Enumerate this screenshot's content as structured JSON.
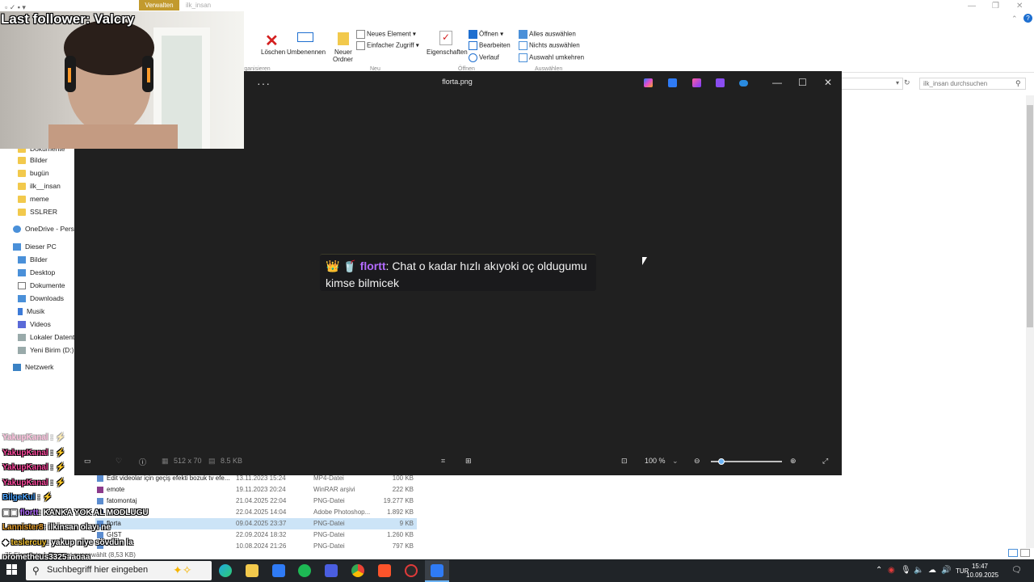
{
  "ribbon": {
    "context_tab": "Verwalten",
    "path_tab": "ilk_insan",
    "delete_label": "Löschen",
    "rename_label": "Umbenennen",
    "new_folder_label_1": "Neuer",
    "new_folder_label_2": "Ordner",
    "new_element_label": "Neues Element",
    "easy_access_label": "Einfacher Zugriff",
    "new_group": "Neu",
    "properties_label": "Eigenschaften",
    "open_label": "Öffnen",
    "edit_label": "Bearbeiten",
    "history_label": "Verlauf",
    "open_group": "Öffnen",
    "select_all": "Alles auswählen",
    "select_none": "Nichts auswählen",
    "invert_selection": "Auswahl umkehren",
    "select_group": "Auswählen",
    "organize_group": "rganisieren"
  },
  "search": {
    "placeholder": "ilk_insan durchsuchen"
  },
  "nav": {
    "items": [
      "Dokumente",
      "Bilder",
      "bugün",
      "ilk__insan",
      "meme",
      "SSLRER",
      "OneDrive - Persor",
      "Dieser PC",
      "Bilder",
      "Desktop",
      "Dokumente",
      "Downloads",
      "Musik",
      "Videos",
      "Lokaler Datentra",
      "Yeni Birim (D:)",
      "Netzwerk"
    ]
  },
  "viewer": {
    "title": "florta.png",
    "more": "···",
    "dimensions": "512 x 70",
    "filesize": "8.5 KB",
    "zoom": "100 %",
    "zoom_level": 0.15
  },
  "chat_message": {
    "emotes": "👑 🥤",
    "user": "flortt",
    "text": ": Chat o kadar hızlı akıyoki oç oldugumu kimse bilmicek"
  },
  "files": [
    {
      "name": "Edit videolar için geçiş efekti bozuk tv efe...",
      "date": "13.11.2023 15:24",
      "type": "MP4-Datei",
      "size": "100 KB"
    },
    {
      "name": "emote",
      "date": "19.11.2023 20:24",
      "type": "WinRAR arşivi",
      "size": "222 KB"
    },
    {
      "name": "fatomontaj",
      "date": "21.04.2025 22:04",
      "type": "PNG-Datei",
      "size": "19.277 KB"
    },
    {
      "name": "",
      "date": "22.04.2025 14:04",
      "type": "Adobe Photoshop...",
      "size": "1.892 KB"
    },
    {
      "name": "florta",
      "date": "09.04.2025 23:37",
      "type": "PNG-Datei",
      "size": "9 KB"
    },
    {
      "name": "GIST",
      "date": "22.09.2024 18:32",
      "type": "PNG-Datei",
      "size": "1.260 KB"
    },
    {
      "name": "",
      "date": "10.08.2024 21:26",
      "type": "PNG-Datei",
      "size": "797 KB"
    }
  ],
  "status_bar": "75 Elemente     1 Element ausgewählt (8,53 KB)",
  "stream": {
    "last_follower": "Last follower: Valcry",
    "chat": [
      {
        "name": "YakupKanal",
        "msg": ""
      },
      {
        "name": "YakupKanal",
        "msg": ""
      },
      {
        "name": "YakupKanal",
        "msg": ""
      },
      {
        "name": "YakupKanal",
        "msg": ""
      },
      {
        "name": "BilgeKul",
        "msg": ""
      },
      {
        "name": "flortt",
        "msg": ": KANKA YOK AL MODLUGU"
      },
      {
        "name": "Lannister8",
        "msg": ": ilkinsan olayı ne"
      },
      {
        "name": "teslercuy",
        "msg": ": yakup niye sövdün la"
      },
      {
        "name": "prometheus3325",
        "msg": ": agaa"
      }
    ]
  },
  "taskbar": {
    "search_placeholder": "Suchbegriff hier eingeben",
    "lang": "TUR",
    "time": "15:47",
    "date": "10.09.2025"
  }
}
